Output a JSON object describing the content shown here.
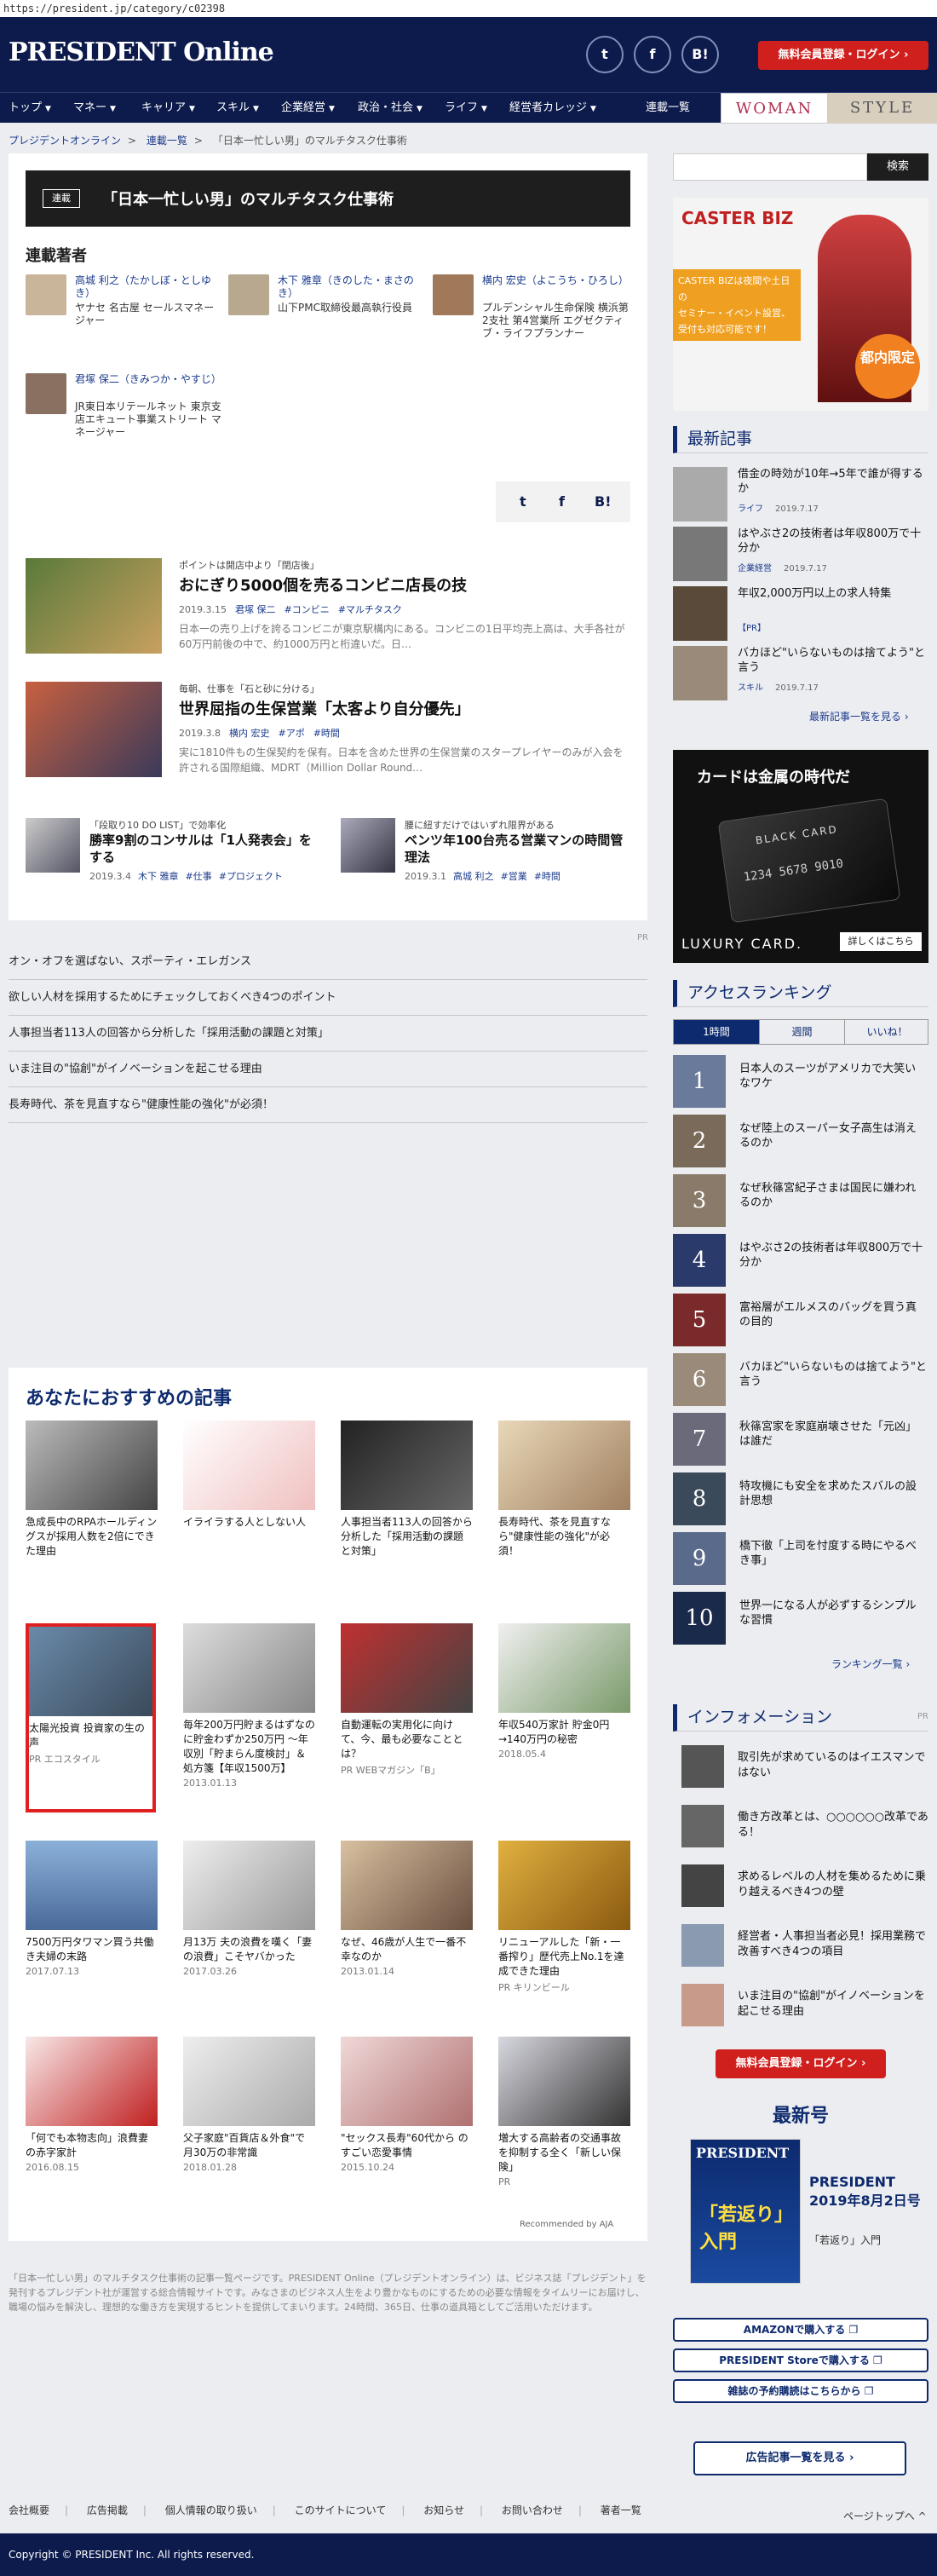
{
  "url": "https://president.jp/category/c02398",
  "header": {
    "logo": "PRESIDENT Online",
    "social": [
      "t",
      "f",
      "B!"
    ],
    "login": "無料会員登録・ログイン",
    "login_arrow": "›"
  },
  "nav": {
    "items": [
      "トップ",
      "マネー",
      "キャリア",
      "スキル",
      "企業経営",
      "政治・社会",
      "ライフ",
      "経営者カレッジ"
    ],
    "series_list": "連載一覧",
    "woman": "WOMAN",
    "style": "STYLE"
  },
  "breadcrumb": [
    "プレジデントオンライン",
    "連載一覧",
    "「日本一忙しい男」のマルチタスク仕事術"
  ],
  "series": {
    "tag": "連載",
    "title": "「日本一忙しい男」のマルチタスク仕事術"
  },
  "authors_heading": "連載著者",
  "authors": [
    {
      "name": "高城 利之（たかしぼ・としゆき）",
      "desc": "ヤナセ 名古屋 セールスマネージャー"
    },
    {
      "name": "木下 雅章（きのした・まさのき）",
      "desc": "山下PMC取締役最高執行役員"
    },
    {
      "name": "横内 宏史（よこうち・ひろし）",
      "desc": "プルデンシャル生命保険 横浜第2支社 第4営業所 エグゼクティブ・ライフプランナー"
    },
    {
      "name": "君塚 保二（きみつか・やすじ）",
      "desc": "JR東日本リテールネット 東京支店エキュート事業ストリート マネージャー"
    }
  ],
  "share": [
    "t",
    "f",
    "B!"
  ],
  "articles": [
    {
      "category": "ポイントは開店中より「閉店後」",
      "title": "おにぎり5000個を売るコンビニ店長の技",
      "date": "2019.3.15",
      "author": "君塚 保二",
      "tags": [
        "#コンビニ",
        "#マルチタスク"
      ],
      "excerpt": "日本一の売り上げを誇るコンビニが東京駅構内にある。コンビニの1日平均売上高は、大手各社が60万円前後の中で、約1000万円と桁違いだ。日…"
    },
    {
      "category": "毎朝、仕事を「石と砂に分ける」",
      "title": "世界屈指の生保営業「太客より自分優先」",
      "date": "2019.3.8",
      "author": "横内 宏史",
      "tags": [
        "#アポ",
        "#時間"
      ],
      "excerpt": "実に1810件もの生保契約を保有。日本を含めた世界の生保営業のスタープレイヤーのみが入会を許される国際組織、MDRT（Million Dollar Round…"
    }
  ],
  "small_articles": [
    {
      "category": "「段取り10 DO LIST」で効率化",
      "title": "勝率9割のコンサルは「1人発表会」をする",
      "date": "2019.3.4",
      "author": "木下 雅章",
      "tags": [
        "#仕事",
        "#プロジェクト"
      ]
    },
    {
      "category": "腰に紐すだけではいずれ限界がある",
      "title": "ベンツ年100台売る営業マンの時間管理法",
      "date": "2019.3.1",
      "author": "高城 利之",
      "tags": [
        "#営業",
        "#時間"
      ]
    }
  ],
  "pr_label": "PR",
  "pr_list": [
    "オン・オフを選ばない、スポーティ・エレガンス",
    "欲しい人材を採用するためにチェックしておくべき4つのポイント",
    "人事担当者113人の回答から分析した「採用活動の課題と対策」",
    "いま注目の\"協創\"がイノベーションを起こせる理由",
    "長寿時代、茶を見直すなら\"健康性能の強化\"が必須！"
  ],
  "recommend": {
    "heading": "あなたにおすすめの記事",
    "row1": [
      {
        "title": "急成長中のRPAホールディングスが採用人数を2倍にできた理由",
        "sub": ""
      },
      {
        "title": "イライラする人としない人",
        "sub": ""
      },
      {
        "title": "人事担当者113人の回答から分析した「採用活動の課題と対策」",
        "sub": ""
      },
      {
        "title": "長寿時代、茶を見直すなら\"健康性能の強化\"が必須！",
        "sub": ""
      }
    ],
    "row2": [
      {
        "title": "太陽光投資 投資家の生の声",
        "sub": "PR エコスタイル"
      },
      {
        "title": "毎年200万円貯まるはずなのに貯金わずか250万円 〜年収別「貯まらん度検討」＆処方箋【年収1500万】",
        "sub": "2013.01.13"
      },
      {
        "title": "自動運転の実用化に向けて、今、最も必要なこととは？",
        "sub": "PR WEBマガジン「B」"
      },
      {
        "title": "年収540万家計 貯金0円→140万円の秘密",
        "sub": "2018.05.4"
      }
    ],
    "row3": [
      {
        "title": "7500万円タワマン買う共働き夫婦の末路",
        "sub": "2017.07.13"
      },
      {
        "title": "月13万 夫の浪費を嘆く「妻の浪費」こそヤバかった",
        "sub": "2017.03.26"
      },
      {
        "title": "なぜ、46歳が人生で一番不幸なのか",
        "sub": "2013.01.14"
      },
      {
        "title": "リニューアルした「新・一番搾り」歴代売上No.1を達成できた理由",
        "sub": "PR キリンビール"
      }
    ],
    "row4": [
      {
        "title": "「何でも本物志向」浪費妻の赤字家計",
        "sub": "2016.08.15"
      },
      {
        "title": "父子家庭\"百貨店＆外食\"で月30万の非常識",
        "sub": "2018.01.28"
      },
      {
        "title": "\"セックス長寿\"60代から のすごい恋愛事情",
        "sub": "2015.10.24"
      },
      {
        "title": "増大する高齢者の交通事故を抑制する全く「新しい保険」",
        "sub": "PR"
      }
    ],
    "footer": "Recommended by AJA"
  },
  "description": "「日本一忙しい男」のマルチタスク仕事術の記事一覧ページです。PRESIDENT Online（プレジデントオンライン）は、ビジネス誌「プレジデント」を発刊するプレジデント社が運営する総合情報サイトです。みなさまのビジネス人生をより豊かなものにするための必要な情報をタイムリーにお届けし、職場の悩みを解決し、理想的な働き方を実現するヒントを提供してまいります。24時間、365日、仕事の道具箱としてご活用いただけます。",
  "sidebar": {
    "search_btn": "検索",
    "ad1_brand": "CASTER BIZ",
    "ad1_lines": [
      "CASTER BIZは夜間や土日の",
      "セミナー・イベント設営、",
      "受付も対応可能です！"
    ],
    "ad1_badge": "都内限定",
    "latest_heading": "最新記事",
    "latest": [
      {
        "title": "借金の時効が10年→5年で誰が得するか",
        "cat": "ライフ",
        "date": "2019.7.17"
      },
      {
        "title": "はやぶさ2の技術者は年収800万で十分か",
        "cat": "企業経営",
        "date": "2019.7.17"
      },
      {
        "title": "年収2,000万円以上の求人特集",
        "cat": "【PR】",
        "date": ""
      },
      {
        "title": "バカほど\"いらないものは捨てよう\"と言う",
        "cat": "スキル",
        "date": "2019.7.17"
      }
    ],
    "latest_more": "最新記事一覧を見る",
    "ad2_headline": "カードは金属の時代だ",
    "ad2_card": "BLACK CARD",
    "ad2_number": "1234 5678 9010",
    "ad2_brand": "LUXURY CARD.",
    "ad2_cta": "詳しくはこちら",
    "ranking_heading": "アクセスランキング",
    "ranking_tabs": [
      "1時間",
      "週間",
      "いいね！"
    ],
    "ranking": [
      "日本人のスーツがアメリカで大笑いなワケ",
      "なぜ陸上のスーパー女子高生は消えるのか",
      "なぜ秋篠宮紀子さまは国民に嫌われるのか",
      "はやぶさ2の技術者は年収800万で十分か",
      "富裕層がエルメスのバッグを買う真の目的",
      "バカほど\"いらないものは捨てよう\"と言う",
      "秋篠宮家を家庭崩壊させた「元凶」は誰だ",
      "特攻機にも安全を求めたスバルの設計思想",
      "橋下徹「上司を忖度する時にやるべき事」",
      "世界一になる人が必ずするシンプルな習慣"
    ],
    "ranking_more": "ランキング一覧",
    "info_heading": "インフォメーション",
    "info_pr": "PR",
    "info": [
      "取引先が求めているのはイエスマンではない",
      "働き方改革とは、○○○○○○改革である！",
      "求めるレベルの人材を集めるために乗り越えるべき4つの壁",
      "経営者・人事担当者必見！採用業務で改善すべき4つの項目",
      "いま注目の\"協創\"がイノベーションを起こせる理由"
    ],
    "login2": "無料会員登録・ログイン",
    "issue_heading": "最新号",
    "issue_title": "PRESIDENT 2019年8月2日号",
    "issue_sub": "「若返り」入門",
    "issue_cover_title": "「若返り」入門",
    "shop": [
      "AMAZONで購入する",
      "PRESIDENT Storeで購入する",
      "雑誌の予約購読はこちらから"
    ]
  },
  "ad_page": "広告記事一覧を見る",
  "footer": {
    "links": [
      "会社概要",
      "広告掲載",
      "個人情報の取り扱い",
      "このサイトについて",
      "お知らせ",
      "お問い合わせ",
      "著者一覧"
    ],
    "page_top": "ページトップへ",
    "copyright": "Copyright © PRESIDENT Inc. All rights reserved."
  }
}
